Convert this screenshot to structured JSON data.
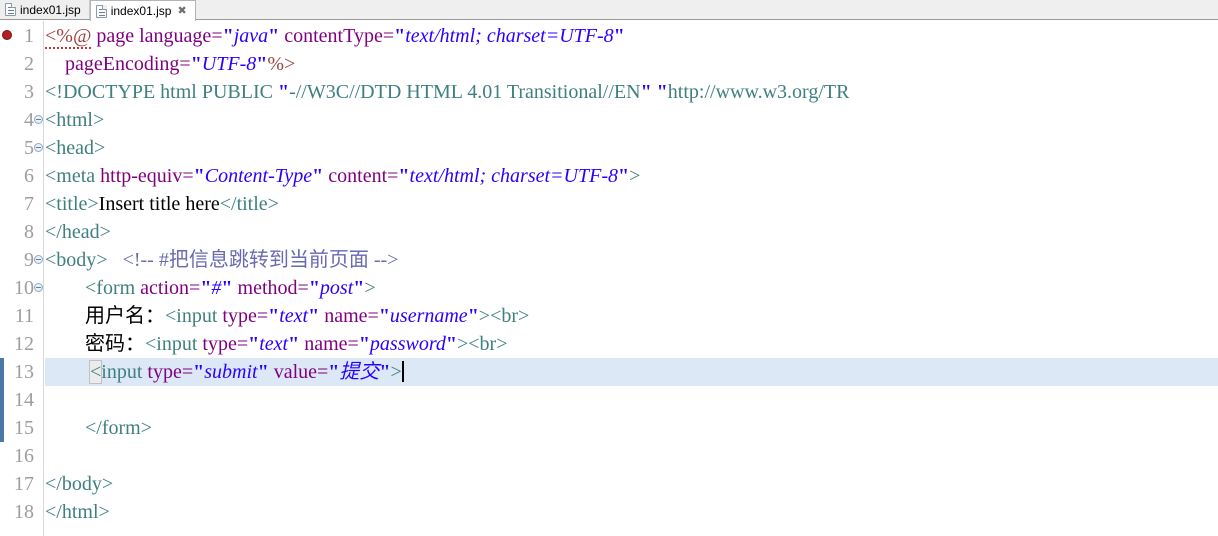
{
  "tabs": [
    {
      "label": "index01.jsp",
      "active": false,
      "icon": "jsp-file-icon",
      "close": ""
    },
    {
      "label": "index01.jsp",
      "active": true,
      "icon": "jsp-file-icon",
      "close": "✖"
    }
  ],
  "editor": {
    "error_marker_line": 1,
    "highlighted_line": 13,
    "change_bar_lines": [
      13,
      14,
      15
    ],
    "fold_lines": [
      4,
      5,
      9,
      10
    ],
    "colors": {
      "tag": "#3f7f7f",
      "attribute": "#7f007f",
      "value": "#2a00ff",
      "comment": "#6a6ab0",
      "jsp_directive": "#a04040",
      "text": "#000000",
      "line_highlight": "#dce8f5",
      "gutter_number": "#9d9d9d",
      "change_bar": "#4a77a8",
      "error_marker": "#b22222"
    },
    "lines": [
      {
        "n": "1",
        "segs": [
          {
            "t": "jsp",
            "s": "<%@",
            "squiggly": true
          },
          {
            "t": "text",
            "s": " "
          },
          {
            "t": "attr",
            "s": "page"
          },
          {
            "t": "text",
            "s": " "
          },
          {
            "t": "attr",
            "s": "language="
          },
          {
            "t": "quote",
            "s": "\""
          },
          {
            "t": "val",
            "s": "java"
          },
          {
            "t": "quote",
            "s": "\""
          },
          {
            "t": "text",
            "s": " "
          },
          {
            "t": "attr",
            "s": "contentType="
          },
          {
            "t": "quote",
            "s": "\""
          },
          {
            "t": "val",
            "s": "text/html; charset=UTF-8"
          },
          {
            "t": "quote",
            "s": "\""
          }
        ]
      },
      {
        "n": "2",
        "segs": [
          {
            "t": "text",
            "s": "    "
          },
          {
            "t": "attr",
            "s": "pageEncoding="
          },
          {
            "t": "quote",
            "s": "\""
          },
          {
            "t": "val",
            "s": "UTF-8"
          },
          {
            "t": "quote",
            "s": "\""
          },
          {
            "t": "jsp",
            "s": "%>"
          }
        ]
      },
      {
        "n": "3",
        "segs": [
          {
            "t": "doctype",
            "s": "<!DOCTYPE html PUBLIC "
          },
          {
            "t": "quote",
            "s": "\""
          },
          {
            "t": "doctype",
            "s": "-//W3C//DTD HTML 4.01 Transitional//EN"
          },
          {
            "t": "quote",
            "s": "\""
          },
          {
            "t": "doctype",
            "s": " "
          },
          {
            "t": "quote",
            "s": "\""
          },
          {
            "t": "doctype",
            "s": "http://www.w3.org/TR"
          }
        ]
      },
      {
        "n": "4",
        "segs": [
          {
            "t": "tag",
            "s": "<html>"
          }
        ]
      },
      {
        "n": "5",
        "segs": [
          {
            "t": "tag",
            "s": "<head>"
          }
        ]
      },
      {
        "n": "6",
        "segs": [
          {
            "t": "tag",
            "s": "<meta"
          },
          {
            "t": "text",
            "s": " "
          },
          {
            "t": "attr",
            "s": "http-equiv="
          },
          {
            "t": "quote",
            "s": "\""
          },
          {
            "t": "val",
            "s": "Content-Type"
          },
          {
            "t": "quote",
            "s": "\""
          },
          {
            "t": "text",
            "s": " "
          },
          {
            "t": "attr",
            "s": "content="
          },
          {
            "t": "quote",
            "s": "\""
          },
          {
            "t": "val",
            "s": "text/html; charset=UTF-8"
          },
          {
            "t": "quote",
            "s": "\""
          },
          {
            "t": "tag",
            "s": ">"
          }
        ]
      },
      {
        "n": "7",
        "segs": [
          {
            "t": "tag",
            "s": "<title>"
          },
          {
            "t": "text",
            "s": "Insert title here"
          },
          {
            "t": "tag",
            "s": "</title>"
          }
        ]
      },
      {
        "n": "8",
        "segs": [
          {
            "t": "tag",
            "s": "</head>"
          }
        ]
      },
      {
        "n": "9",
        "segs": [
          {
            "t": "tag",
            "s": "<body>"
          },
          {
            "t": "text",
            "s": "   "
          },
          {
            "t": "cmt",
            "s": "<!-- #把信息跳转到当前页面 -->"
          }
        ]
      },
      {
        "n": "10",
        "segs": [
          {
            "t": "text",
            "s": "        "
          },
          {
            "t": "tag",
            "s": "<form"
          },
          {
            "t": "text",
            "s": " "
          },
          {
            "t": "attr",
            "s": "action="
          },
          {
            "t": "quote",
            "s": "\""
          },
          {
            "t": "val",
            "s": "#"
          },
          {
            "t": "quote",
            "s": "\""
          },
          {
            "t": "text",
            "s": " "
          },
          {
            "t": "attr",
            "s": "method="
          },
          {
            "t": "quote",
            "s": "\""
          },
          {
            "t": "val",
            "s": "post"
          },
          {
            "t": "quote",
            "s": "\""
          },
          {
            "t": "tag",
            "s": ">"
          }
        ]
      },
      {
        "n": "11",
        "segs": [
          {
            "t": "text",
            "s": "        用户名："
          },
          {
            "t": "tag",
            "s": "<input"
          },
          {
            "t": "text",
            "s": " "
          },
          {
            "t": "attr",
            "s": "type="
          },
          {
            "t": "quote",
            "s": "\""
          },
          {
            "t": "val",
            "s": "text"
          },
          {
            "t": "quote",
            "s": "\""
          },
          {
            "t": "text",
            "s": " "
          },
          {
            "t": "attr",
            "s": "name="
          },
          {
            "t": "quote",
            "s": "\""
          },
          {
            "t": "val",
            "s": "username"
          },
          {
            "t": "quote",
            "s": "\""
          },
          {
            "t": "tag",
            "s": ">"
          },
          {
            "t": "tag",
            "s": "<br>"
          }
        ]
      },
      {
        "n": "12",
        "segs": [
          {
            "t": "text",
            "s": "        密码："
          },
          {
            "t": "tag",
            "s": "<input"
          },
          {
            "t": "text",
            "s": " "
          },
          {
            "t": "attr",
            "s": "type="
          },
          {
            "t": "quote",
            "s": "\""
          },
          {
            "t": "val",
            "s": "text"
          },
          {
            "t": "quote",
            "s": "\""
          },
          {
            "t": "text",
            "s": " "
          },
          {
            "t": "attr",
            "s": "name="
          },
          {
            "t": "quote",
            "s": "\""
          },
          {
            "t": "val",
            "s": "password"
          },
          {
            "t": "quote",
            "s": "\""
          },
          {
            "t": "tag",
            "s": ">"
          },
          {
            "t": "tag",
            "s": "<br>"
          }
        ]
      },
      {
        "n": "13",
        "segs": [
          {
            "t": "text",
            "s": "         "
          },
          {
            "t": "tag",
            "s": "<",
            "bracket": true
          },
          {
            "t": "tag",
            "s": "input"
          },
          {
            "t": "text",
            "s": " "
          },
          {
            "t": "attr",
            "s": "type="
          },
          {
            "t": "quote",
            "s": "\""
          },
          {
            "t": "val",
            "s": "submit"
          },
          {
            "t": "quote",
            "s": "\""
          },
          {
            "t": "text",
            "s": " "
          },
          {
            "t": "attr",
            "s": "value="
          },
          {
            "t": "quote",
            "s": "\""
          },
          {
            "t": "val",
            "s": "提交"
          },
          {
            "t": "quote",
            "s": "\""
          },
          {
            "t": "tag",
            "s": ">"
          },
          {
            "t": "caret",
            "s": ""
          }
        ]
      },
      {
        "n": "14",
        "segs": []
      },
      {
        "n": "15",
        "segs": [
          {
            "t": "text",
            "s": "        "
          },
          {
            "t": "tag",
            "s": "</form>"
          }
        ]
      },
      {
        "n": "16",
        "segs": []
      },
      {
        "n": "17",
        "segs": [
          {
            "t": "tag",
            "s": "</body>"
          }
        ]
      },
      {
        "n": "18",
        "segs": [
          {
            "t": "tag",
            "s": "</html>"
          }
        ]
      }
    ]
  }
}
